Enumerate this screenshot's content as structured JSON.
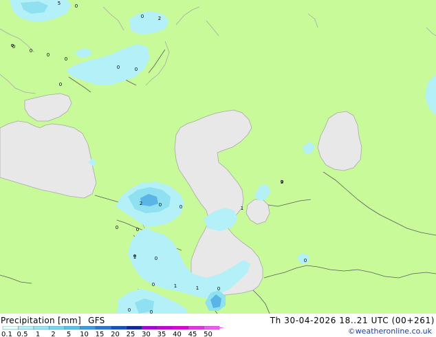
{
  "product": {
    "label": "Precipitation [mm]",
    "model": "GFS",
    "valid_time": "Th 30-04-2026 18..21 UTC (00+261)",
    "credit": "©weatheronline.co.uk"
  },
  "legend": {
    "ticks": [
      "0.1",
      "0.5",
      "1",
      "2",
      "5",
      "10",
      "15",
      "20",
      "25",
      "30",
      "35",
      "40",
      "45",
      "50"
    ],
    "colors": [
      "#e0fffe",
      "#b4f0fa",
      "#96e6f5",
      "#78d7f0",
      "#5ac3eb",
      "#3c9be1",
      "#2878d2",
      "#1450c3",
      "#0a28a0",
      "#aa00dc",
      "#c800dc",
      "#dc00dc",
      "#e632e6",
      "#f05af0"
    ]
  },
  "map_colors": {
    "land": "#c8fa9a",
    "sea": "#e8e8e8",
    "precip_light": "#b4f0f8",
    "precip_medium": "#8fe0f0",
    "precip_heavy": "#5ab4e6",
    "coast": "#a8a8a8",
    "border": "#5a5a5a"
  },
  "precip_values": [
    {
      "id": "v1",
      "text": "5"
    },
    {
      "id": "v2",
      "text": "0"
    },
    {
      "id": "v3",
      "text": "0"
    },
    {
      "id": "v4",
      "text": "2"
    },
    {
      "id": "v5",
      "text": "0"
    },
    {
      "id": "v6",
      "text": "0"
    },
    {
      "id": "v7",
      "text": "0"
    },
    {
      "id": "v8",
      "text": "0"
    },
    {
      "id": "v9",
      "text": "0"
    },
    {
      "id": "v10",
      "text": "0"
    },
    {
      "id": "v11",
      "text": "0"
    },
    {
      "id": "v12",
      "text": "3"
    },
    {
      "id": "v13",
      "text": "2"
    },
    {
      "id": "v14",
      "text": "0"
    },
    {
      "id": "v15",
      "text": "0"
    },
    {
      "id": "v16",
      "text": "1"
    },
    {
      "id": "v17",
      "text": "0"
    },
    {
      "id": "v18",
      "text": "0"
    },
    {
      "id": "v19",
      "text": "1"
    },
    {
      "id": "v20",
      "text": "0"
    },
    {
      "id": "v21",
      "text": "0"
    },
    {
      "id": "v22",
      "text": "0"
    },
    {
      "id": "v23",
      "text": "1"
    },
    {
      "id": "v24",
      "text": "1"
    },
    {
      "id": "v25",
      "text": "0"
    },
    {
      "id": "v26",
      "text": "0"
    },
    {
      "id": "v27",
      "text": "0"
    }
  ]
}
